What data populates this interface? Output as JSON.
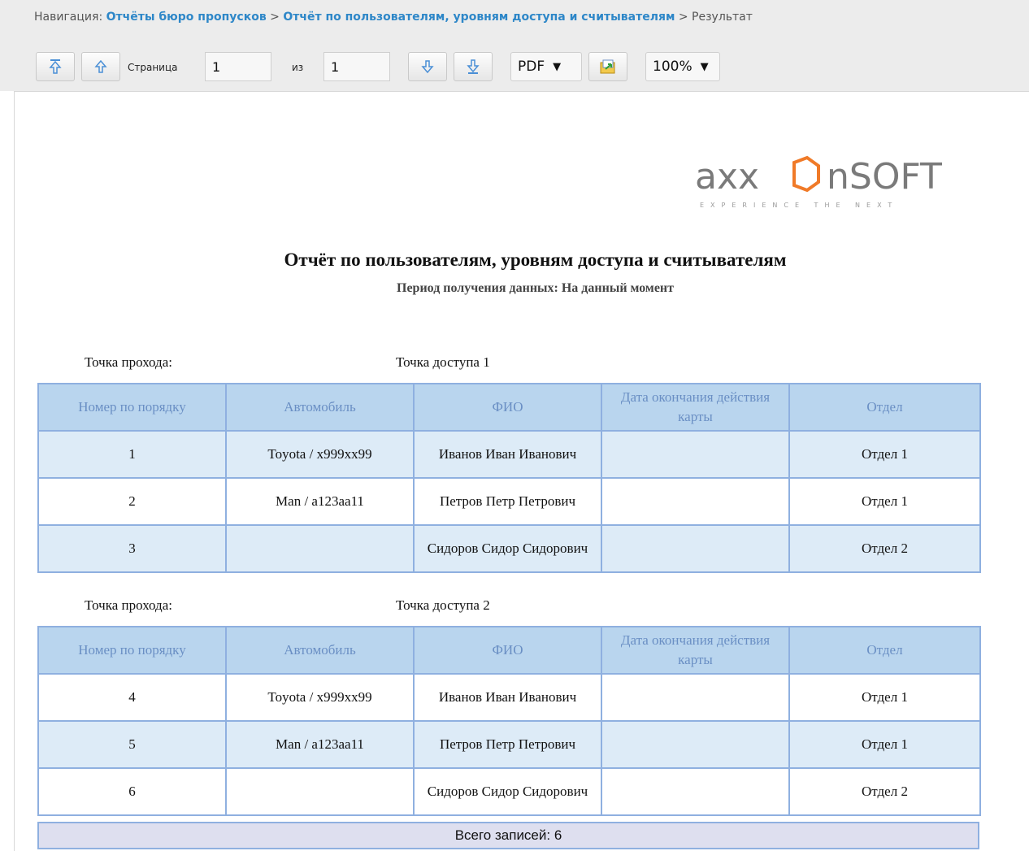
{
  "nav": {
    "prefix": "Навигация:",
    "crumb1": "Отчёты бюро пропусков",
    "crumb2": "Отчёт по пользователям, уровням доступа и считывателям",
    "current": "Результат",
    "separator": ">"
  },
  "toolbar": {
    "page_label": "Страница",
    "page_value": "1",
    "of_label": "из",
    "total_pages": "1",
    "format_selected": "PDF",
    "zoom_selected": "100%"
  },
  "report": {
    "logo_text": "axxonsoft",
    "logo_tagline": "EXPERIENCE THE NEXT",
    "title": "Отчёт по пользователям, уровням доступа и считывателям",
    "subtitle": "Период получения данных: На данный момент",
    "columns": [
      "Номер по порядку",
      "Автомобиль",
      "ФИО",
      "Дата окончания действия карты",
      "Отдел"
    ],
    "groups": [
      {
        "point_label": "Точка прохода:",
        "point_value": "Точка доступа 1",
        "rows": [
          [
            "1",
            "Toyota / x999xx99",
            "Иванов Иван Иванович",
            "",
            "Отдел 1"
          ],
          [
            "2",
            "Man / a123aa11",
            "Петров Петр Петрович",
            "",
            "Отдел 1"
          ],
          [
            "3",
            "",
            "Сидоров Сидор Сидорович",
            "",
            "Отдел 2"
          ]
        ]
      },
      {
        "point_label": "Точка прохода:",
        "point_value": "Точка доступа 2",
        "rows": [
          [
            "4",
            "Toyota / x999xx99",
            "Иванов Иван Иванович",
            "",
            "Отдел 1"
          ],
          [
            "5",
            "Man / a123aa11",
            "Петров Петр Петрович",
            "",
            "Отдел 1"
          ],
          [
            "6",
            "",
            "Сидоров Сидор Сидорович",
            "",
            "Отдел 2"
          ]
        ]
      }
    ],
    "total": "Всего записей: 6"
  },
  "colors": {
    "accent": "#2e87c8",
    "header_bg": "#b9d5ee",
    "header_text": "#6a8fc4",
    "row_alt_bg": "#ddebf7",
    "border": "#8fb0e0",
    "total_bg": "#dedfef"
  },
  "icons": [
    "first-page-icon",
    "previous-page-icon",
    "next-page-icon",
    "last-page-icon",
    "export-icon",
    "chevron-down-icon"
  ]
}
